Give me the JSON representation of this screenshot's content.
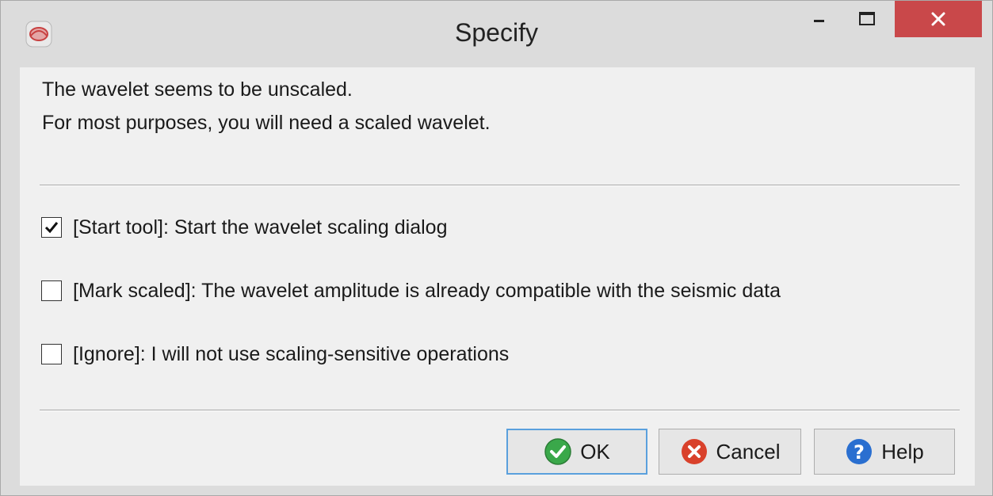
{
  "window": {
    "title": "Specify"
  },
  "message": {
    "line1": "The wavelet seems to be unscaled.",
    "line2": "For most purposes, you will need a scaled wavelet."
  },
  "options": [
    {
      "label": "[Start tool]: Start the wavelet scaling dialog",
      "checked": true
    },
    {
      "label": "[Mark scaled]: The wavelet amplitude is already compatible with the seismic data",
      "checked": false
    },
    {
      "label": "[Ignore]: I will not use scaling-sensitive operations",
      "checked": false
    }
  ],
  "buttons": {
    "ok": "OK",
    "cancel": "Cancel",
    "help": "Help"
  },
  "colors": {
    "close_button": "#c9484a",
    "ok_icon": "#3aa84a",
    "cancel_icon": "#d9412b",
    "help_icon": "#2a6fd0",
    "focus_border": "#5aa0dd"
  },
  "icons": {
    "app": "app-icon",
    "minimize": "minimize-icon",
    "maximize": "maximize-icon",
    "close": "close-icon",
    "ok": "check-circle-icon",
    "cancel": "x-circle-icon",
    "help": "question-circle-icon"
  }
}
